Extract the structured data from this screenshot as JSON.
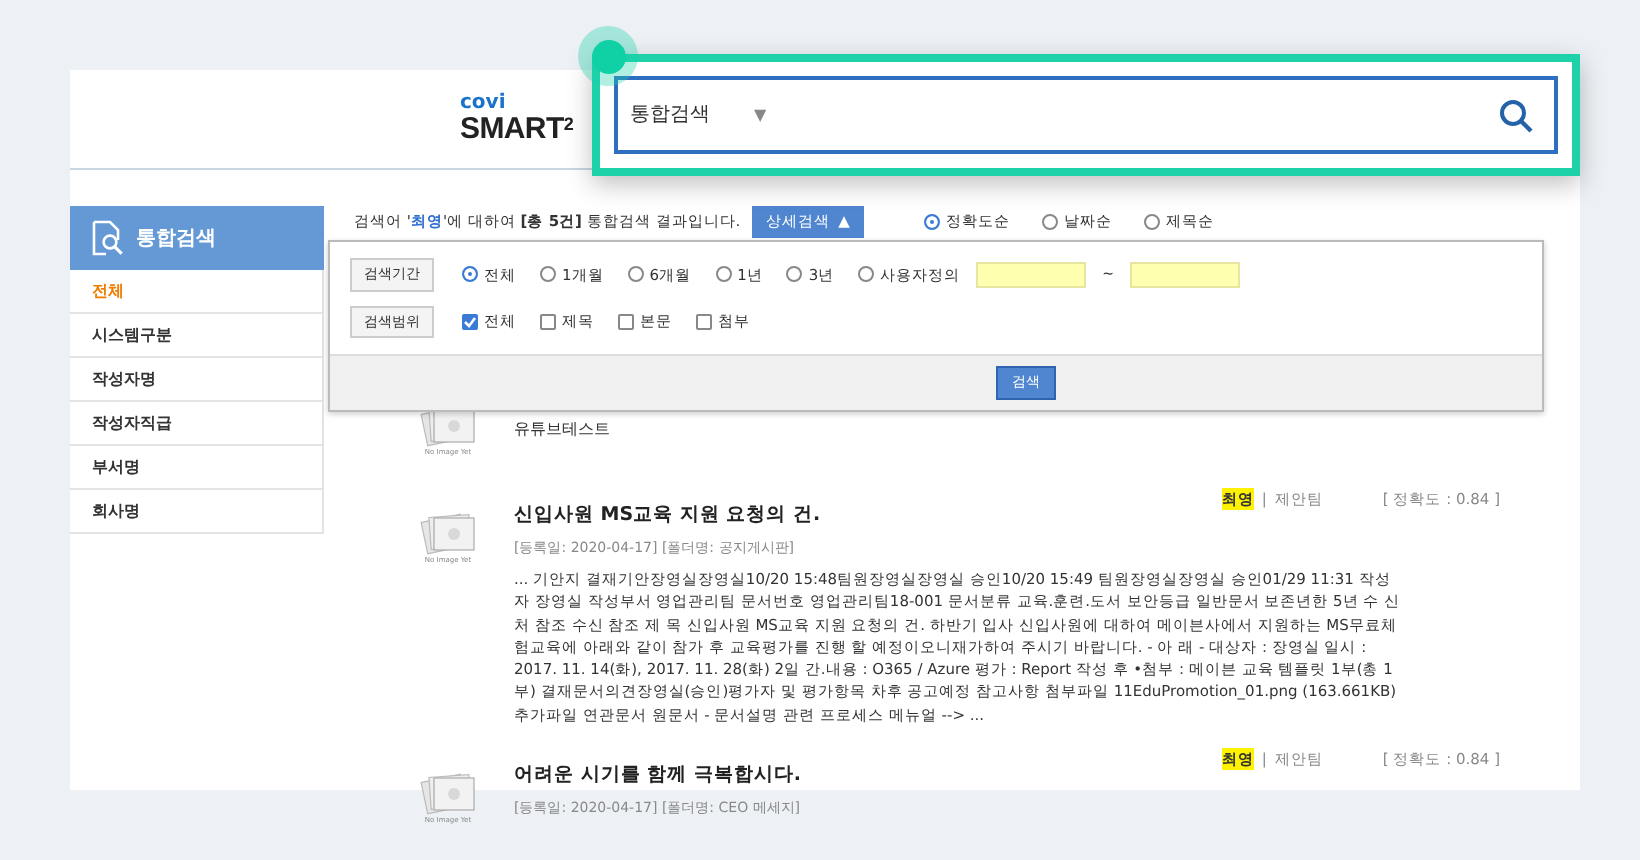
{
  "logo": {
    "brand": "covi",
    "product": "SMART$^{2}$"
  },
  "search_box": {
    "scope": "통합검색",
    "caret": "▼"
  },
  "sidebar": {
    "title": "통합검색",
    "items": [
      {
        "label": "전체",
        "selected": true
      },
      {
        "label": "시스템구분",
        "selected": false
      },
      {
        "label": "작성자명",
        "selected": false
      },
      {
        "label": "작성자직급",
        "selected": false
      },
      {
        "label": "부서명",
        "selected": false
      },
      {
        "label": "회사명",
        "selected": false
      }
    ]
  },
  "summary": "검색어 '**최영**'에 대하여 **[총 5건]** 통합검색 결과입니다.",
  "detail_toggle": {
    "label": "상세검색",
    "caret": "▲",
    "expanded": true
  },
  "sort_options": [
    {
      "label": "정확도순",
      "selected": true
    },
    {
      "label": "날짜순",
      "selected": false
    },
    {
      "label": "제목순",
      "selected": false
    }
  ],
  "detail_panel": {
    "period": {
      "label": "검색기간",
      "options": [
        {
          "label": "전체",
          "selected": true
        },
        {
          "label": "1개월",
          "selected": false
        },
        {
          "label": "6개월",
          "selected": false
        },
        {
          "label": "1년",
          "selected": false
        },
        {
          "label": "3년",
          "selected": false
        },
        {
          "label": "사용자정의",
          "selected": false
        }
      ],
      "range_separator": "~"
    },
    "scope": {
      "label": "검색범위",
      "options": [
        {
          "label": "전체",
          "checked": true
        },
        {
          "label": "제목",
          "checked": false
        },
        {
          "label": "본문",
          "checked": false
        },
        {
          "label": "첨부",
          "checked": false
        }
      ]
    },
    "search_button": "검색"
  },
  "results": [
    {
      "thumbnail_caption": "No Image Yet",
      "snippet": "유튜브테스트"
    },
    {
      "thumbnail_caption": "No Image Yet",
      "title": "신입사원 MS교육 지원 요청의 건.",
      "info": "[등록일: 2020-04-17]  [폴더명: 공지게시판]",
      "author": "최영",
      "separator": "|",
      "team": "제안팀",
      "accuracy": "[ 정확도 : 0.84 ]",
      "snippet": "... 기안지 결재기안장영실장영실10/20 15:48팀원장영실장영실 승인10/20 15:49 팀원장영실장영실 승인01/29 11:31 작성자 장영실 작성부서 영업관리팀 문서번호 영업관리팀18-001 문서분류 교육.훈련.도서 보안등급 일반문서 보존년한 5년 수 신 처 참조 수신 참조 제 목 신입사원 MS교육 지원 요청의 건. 하반기 입사 신입사원에 대하여 메이븐사에서 지원하는 MS무료체험교육에 아래와 같이 참가 후 교육평가를 진행 할 예정이오니재가하여 주시기 바랍니다. - 아 래 - 대상자 : 장영실 일시 : 2017. 11. 14(화), 2017. 11. 28(화) 2일 간.내용 : O365 / Azure 평가 : Report 작성 후 •첨부 : 메이븐 교육 템플릿 1부(총 1부) 결재문서의견장영실(승인)평가자 및 평가항목 차후 공고예정 참고사항 첨부파일 11EduPromotion_01.png (163.661KB) 추가파일 연관문서 원문서 - 문서설명 관련 프로세스 메뉴얼 --> ..."
    },
    {
      "thumbnail_caption": "No Image Yet",
      "title": "어려운 시기를 함께 극복합시다.",
      "info": "[등록일: 2020-04-17]  [폴더명: CEO 메세지]",
      "author": "최영",
      "separator": "|",
      "team": "제안팀",
      "accuracy": "[ 정확도 : 0.84 ]"
    }
  ]
}
